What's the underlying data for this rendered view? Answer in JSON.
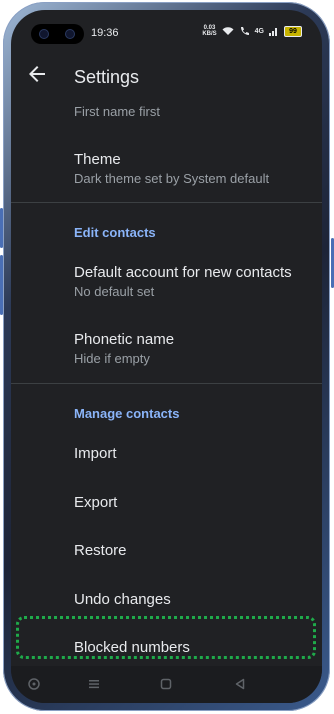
{
  "status_bar": {
    "time": "19:36",
    "network_speed_value": "0.03",
    "network_speed_unit": "KB/S",
    "signal_label": "4G",
    "battery": "99"
  },
  "app_bar": {
    "title": "Settings",
    "back_icon": "arrow-back-icon"
  },
  "settings": {
    "name_format_value": "First name first",
    "theme": {
      "label": "Theme",
      "value": "Dark theme set by System default"
    },
    "edit_contacts_header": "Edit contacts",
    "default_account": {
      "label": "Default account for new contacts",
      "value": "No default set"
    },
    "phonetic_name": {
      "label": "Phonetic name",
      "value": "Hide if empty"
    },
    "manage_contacts_header": "Manage contacts",
    "import_label": "Import",
    "export_label": "Export",
    "restore_label": "Restore",
    "undo_label": "Undo changes",
    "blocked_label": "Blocked numbers"
  },
  "colors": {
    "background": "#202124",
    "accent": "#8ab4f8",
    "highlight": "#1faa4a"
  }
}
